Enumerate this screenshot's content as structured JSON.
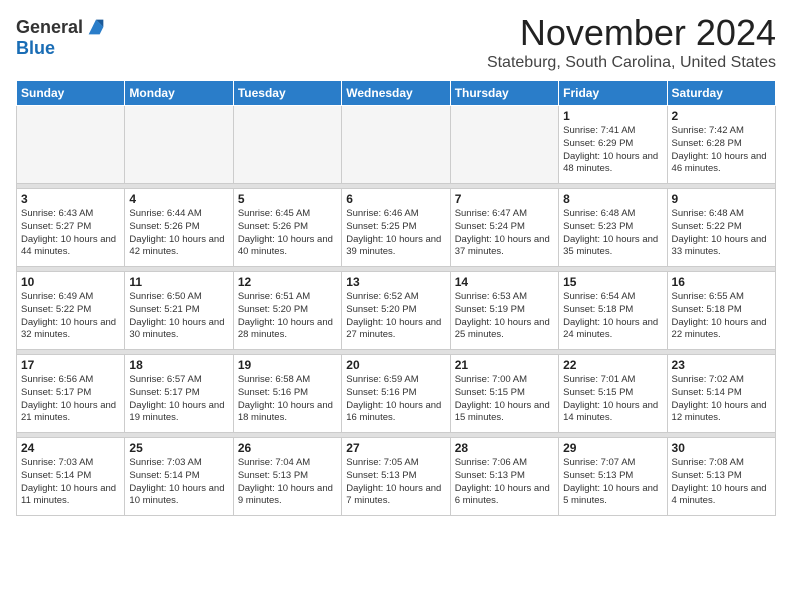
{
  "logo": {
    "general": "General",
    "blue": "Blue"
  },
  "title": "November 2024",
  "location": "Stateburg, South Carolina, United States",
  "days_of_week": [
    "Sunday",
    "Monday",
    "Tuesday",
    "Wednesday",
    "Thursday",
    "Friday",
    "Saturday"
  ],
  "weeks": [
    [
      {
        "day": "",
        "info": ""
      },
      {
        "day": "",
        "info": ""
      },
      {
        "day": "",
        "info": ""
      },
      {
        "day": "",
        "info": ""
      },
      {
        "day": "",
        "info": ""
      },
      {
        "day": "1",
        "info": "Sunrise: 7:41 AM\nSunset: 6:29 PM\nDaylight: 10 hours and 48 minutes."
      },
      {
        "day": "2",
        "info": "Sunrise: 7:42 AM\nSunset: 6:28 PM\nDaylight: 10 hours and 46 minutes."
      }
    ],
    [
      {
        "day": "3",
        "info": "Sunrise: 6:43 AM\nSunset: 5:27 PM\nDaylight: 10 hours and 44 minutes."
      },
      {
        "day": "4",
        "info": "Sunrise: 6:44 AM\nSunset: 5:26 PM\nDaylight: 10 hours and 42 minutes."
      },
      {
        "day": "5",
        "info": "Sunrise: 6:45 AM\nSunset: 5:26 PM\nDaylight: 10 hours and 40 minutes."
      },
      {
        "day": "6",
        "info": "Sunrise: 6:46 AM\nSunset: 5:25 PM\nDaylight: 10 hours and 39 minutes."
      },
      {
        "day": "7",
        "info": "Sunrise: 6:47 AM\nSunset: 5:24 PM\nDaylight: 10 hours and 37 minutes."
      },
      {
        "day": "8",
        "info": "Sunrise: 6:48 AM\nSunset: 5:23 PM\nDaylight: 10 hours and 35 minutes."
      },
      {
        "day": "9",
        "info": "Sunrise: 6:48 AM\nSunset: 5:22 PM\nDaylight: 10 hours and 33 minutes."
      }
    ],
    [
      {
        "day": "10",
        "info": "Sunrise: 6:49 AM\nSunset: 5:22 PM\nDaylight: 10 hours and 32 minutes."
      },
      {
        "day": "11",
        "info": "Sunrise: 6:50 AM\nSunset: 5:21 PM\nDaylight: 10 hours and 30 minutes."
      },
      {
        "day": "12",
        "info": "Sunrise: 6:51 AM\nSunset: 5:20 PM\nDaylight: 10 hours and 28 minutes."
      },
      {
        "day": "13",
        "info": "Sunrise: 6:52 AM\nSunset: 5:20 PM\nDaylight: 10 hours and 27 minutes."
      },
      {
        "day": "14",
        "info": "Sunrise: 6:53 AM\nSunset: 5:19 PM\nDaylight: 10 hours and 25 minutes."
      },
      {
        "day": "15",
        "info": "Sunrise: 6:54 AM\nSunset: 5:18 PM\nDaylight: 10 hours and 24 minutes."
      },
      {
        "day": "16",
        "info": "Sunrise: 6:55 AM\nSunset: 5:18 PM\nDaylight: 10 hours and 22 minutes."
      }
    ],
    [
      {
        "day": "17",
        "info": "Sunrise: 6:56 AM\nSunset: 5:17 PM\nDaylight: 10 hours and 21 minutes."
      },
      {
        "day": "18",
        "info": "Sunrise: 6:57 AM\nSunset: 5:17 PM\nDaylight: 10 hours and 19 minutes."
      },
      {
        "day": "19",
        "info": "Sunrise: 6:58 AM\nSunset: 5:16 PM\nDaylight: 10 hours and 18 minutes."
      },
      {
        "day": "20",
        "info": "Sunrise: 6:59 AM\nSunset: 5:16 PM\nDaylight: 10 hours and 16 minutes."
      },
      {
        "day": "21",
        "info": "Sunrise: 7:00 AM\nSunset: 5:15 PM\nDaylight: 10 hours and 15 minutes."
      },
      {
        "day": "22",
        "info": "Sunrise: 7:01 AM\nSunset: 5:15 PM\nDaylight: 10 hours and 14 minutes."
      },
      {
        "day": "23",
        "info": "Sunrise: 7:02 AM\nSunset: 5:14 PM\nDaylight: 10 hours and 12 minutes."
      }
    ],
    [
      {
        "day": "24",
        "info": "Sunrise: 7:03 AM\nSunset: 5:14 PM\nDaylight: 10 hours and 11 minutes."
      },
      {
        "day": "25",
        "info": "Sunrise: 7:03 AM\nSunset: 5:14 PM\nDaylight: 10 hours and 10 minutes."
      },
      {
        "day": "26",
        "info": "Sunrise: 7:04 AM\nSunset: 5:13 PM\nDaylight: 10 hours and 9 minutes."
      },
      {
        "day": "27",
        "info": "Sunrise: 7:05 AM\nSunset: 5:13 PM\nDaylight: 10 hours and 7 minutes."
      },
      {
        "day": "28",
        "info": "Sunrise: 7:06 AM\nSunset: 5:13 PM\nDaylight: 10 hours and 6 minutes."
      },
      {
        "day": "29",
        "info": "Sunrise: 7:07 AM\nSunset: 5:13 PM\nDaylight: 10 hours and 5 minutes."
      },
      {
        "day": "30",
        "info": "Sunrise: 7:08 AM\nSunset: 5:13 PM\nDaylight: 10 hours and 4 minutes."
      }
    ]
  ]
}
